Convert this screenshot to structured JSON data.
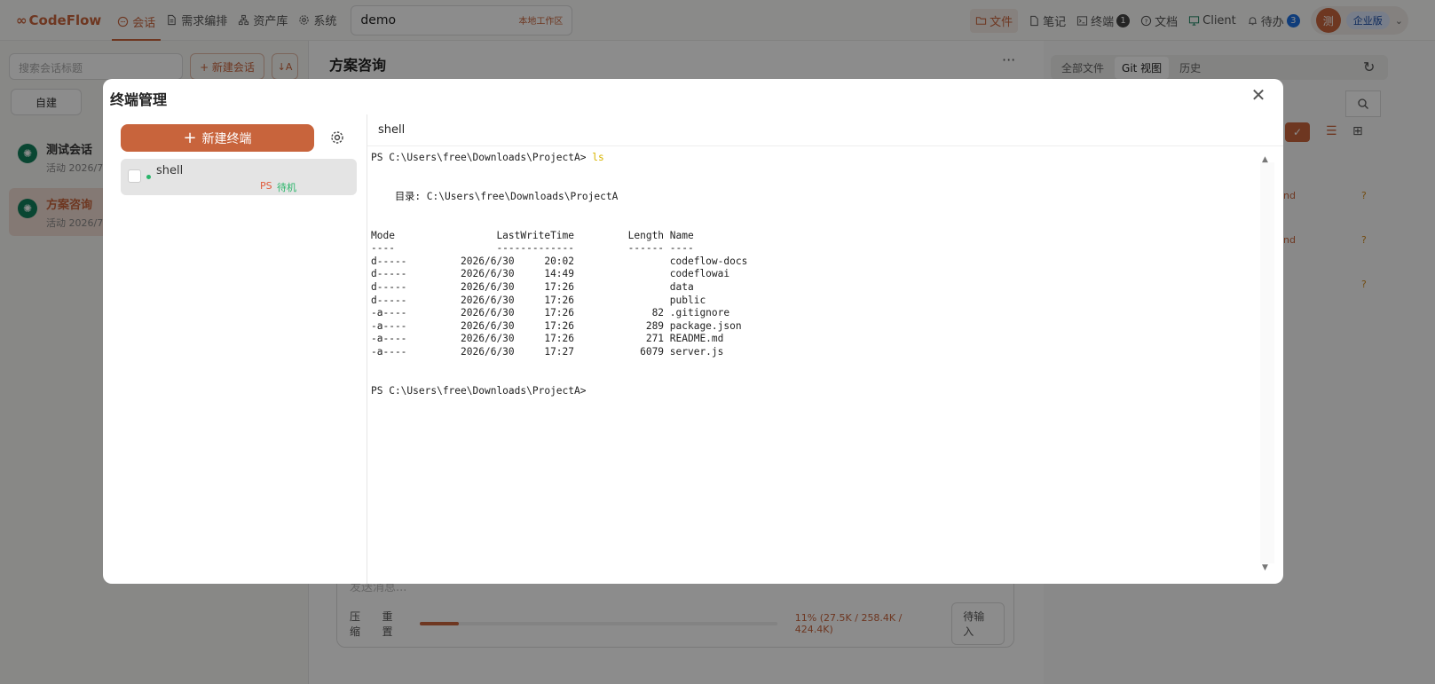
{
  "app": {
    "logo_text": "CodeFlow"
  },
  "nav": [
    {
      "label": "会话",
      "icon": "chat-icon",
      "active": true
    },
    {
      "label": "需求编排",
      "icon": "document-icon",
      "active": false
    },
    {
      "label": "资产库",
      "icon": "sitemap-icon",
      "active": false
    },
    {
      "label": "系统",
      "icon": "gear-icon",
      "active": false
    }
  ],
  "workspace": {
    "name": "demo",
    "tag": "本地工作区"
  },
  "right_nav": {
    "files": "文件",
    "notes": "笔记",
    "terminal": "终端",
    "terminal_count": "1",
    "docs": "文档",
    "client": "Client",
    "todo": "待办",
    "todo_count": "3",
    "avatar": "测",
    "plan": "企业版"
  },
  "sidebar": {
    "search_placeholder": "搜索会话标题",
    "new_session": "+ 新建会话",
    "tab_self": "自建",
    "sessions": [
      {
        "title": "测试会话",
        "sub": "活动 2026/7/"
      },
      {
        "title": "方案咨询",
        "sub": "活动 2026/7/"
      }
    ]
  },
  "main": {
    "title": "方案咨询",
    "more": "···",
    "composer_placeholder": "发送消息...",
    "compress": "压缩",
    "reset": "重置",
    "usage_text": "11% (27.5K / 258.4K / 424.4K)",
    "usage_fraction": 0.11,
    "send_label": "待输入"
  },
  "right_panel": {
    "tabs": [
      "全部文件",
      "Git 视图",
      "历史"
    ],
    "active_tab": 1,
    "file_suffix": "nd",
    "status_q": "?"
  },
  "modal": {
    "title": "终端管理",
    "close": "✕",
    "new_terminal": "新建终端",
    "terminals": [
      {
        "name": "shell",
        "shell": "PS",
        "state": "待机"
      }
    ],
    "active_terminal_name": "shell",
    "console": {
      "prompt": "PS C:\\Users\\free\\Downloads\\ProjectA> ",
      "command": "ls",
      "dir_line": "    目录: C:\\Users\\free\\Downloads\\ProjectA",
      "header": "Mode                 LastWriteTime         Length Name",
      "divider": "----                 -------------         ------ ----",
      "rows": [
        "d-----         2026/6/30     20:02                codeflow-docs",
        "d-----         2026/6/30     14:49                codeflowai",
        "d-----         2026/6/30     17:26                data",
        "d-----         2026/6/30     17:26                public",
        "-a----         2026/6/30     17:26             82 .gitignore",
        "-a----         2026/6/30     17:26            289 package.json",
        "-a----         2026/6/30     17:26            271 README.md",
        "-a----         2026/6/30     17:27           6079 server.js"
      ],
      "final_prompt": "PS C:\\Users\\free\\Downloads\\ProjectA>"
    }
  }
}
